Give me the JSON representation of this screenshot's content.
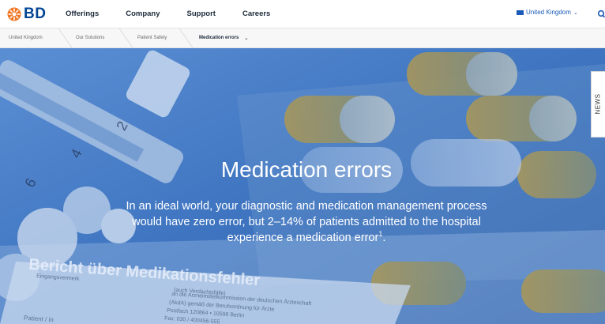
{
  "header": {
    "logo_text": "BD",
    "nav_items": [
      {
        "label": "Offerings"
      },
      {
        "label": "Company"
      },
      {
        "label": "Support"
      },
      {
        "label": "Careers"
      }
    ],
    "region_label": "United Kingdom",
    "search_icon": "search-icon"
  },
  "breadcrumb": {
    "items": [
      {
        "label": "United Kingdom"
      },
      {
        "label": "Our Solutions"
      },
      {
        "label": "Patient Safety"
      },
      {
        "label": "Medication errors"
      }
    ]
  },
  "hero": {
    "title": "Medication errors",
    "subtitle": "In an ideal world, your diagnostic and medication management process would have zero error, but 2–14% of patients admitted to the hospital experience a medication error",
    "footnote_mark": "1",
    "subtitle_end": ".",
    "background_text": {
      "doc_heading": "Bericht über Medikationsfehler",
      "doc_line1": "Eingangsvermerk",
      "doc_line2": "(auch Verdachtsfälle)",
      "doc_line3": "an die Arzneimittelkommission der deutschen Ärzteschaft",
      "doc_line4": "(AkdA) gemäß der Berufsordnung für Ärzte",
      "doc_line5": "Postfach 120864 • 10598 Berlin",
      "doc_line6": "Fax: 030 / 400456-555",
      "doc_line7": "Patient / in",
      "syringe_marks": [
        "2",
        "4",
        "6"
      ]
    }
  },
  "news_tab": {
    "label": "NEWS"
  },
  "colors": {
    "brand_blue": "#004593",
    "brand_orange": "#ef7622",
    "hero_overlay": "#3f76c2"
  }
}
